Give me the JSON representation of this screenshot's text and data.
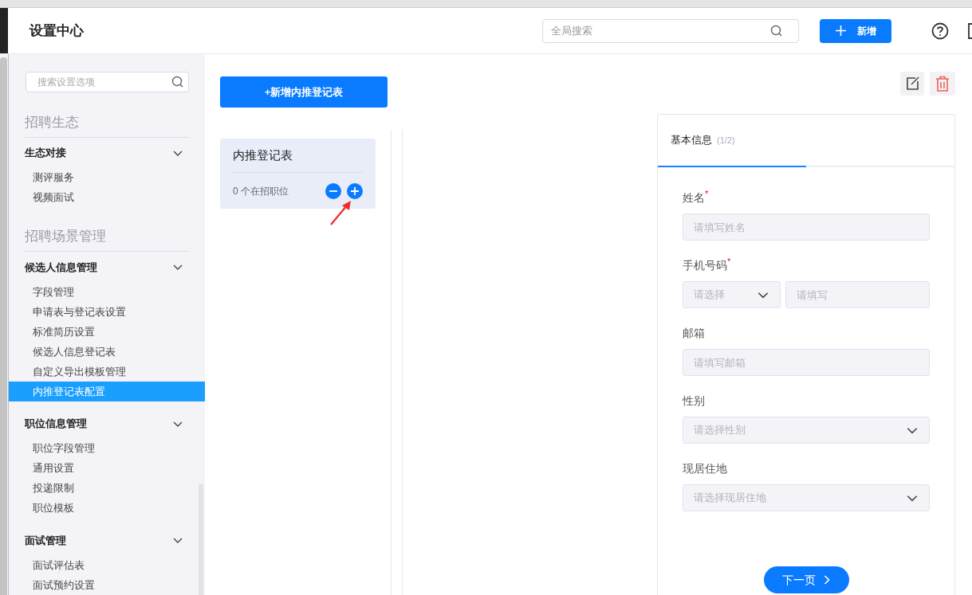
{
  "header": {
    "title": "设置中心",
    "search": {
      "placeholder": "全局搜索"
    },
    "add_button": "新增"
  },
  "sidebar": {
    "search": {
      "placeholder": "搜索设置选项"
    },
    "sections": [
      {
        "title": "招聘生态",
        "groups": [
          {
            "label": "生态对接",
            "expanded": true,
            "items": [
              {
                "label": "测评服务",
                "selected": false
              },
              {
                "label": "视频面试",
                "selected": false
              }
            ]
          }
        ]
      },
      {
        "title": "招聘场景管理",
        "groups": [
          {
            "label": "候选人信息管理",
            "expanded": true,
            "items": [
              {
                "label": "字段管理",
                "selected": false
              },
              {
                "label": "申请表与登记表设置",
                "selected": false
              },
              {
                "label": "标准简历设置",
                "selected": false
              },
              {
                "label": "候选人信息登记表",
                "selected": false
              },
              {
                "label": "自定义导出模板管理",
                "selected": false
              },
              {
                "label": "内推登记表配置",
                "selected": true
              }
            ]
          },
          {
            "label": "职位信息管理",
            "expanded": true,
            "items": [
              {
                "label": "职位字段管理",
                "selected": false
              },
              {
                "label": "通用设置",
                "selected": false
              },
              {
                "label": "投递限制",
                "selected": false
              },
              {
                "label": "职位模板",
                "selected": false
              }
            ]
          },
          {
            "label": "面试管理",
            "expanded": true,
            "items": [
              {
                "label": "面试评估表",
                "selected": false
              },
              {
                "label": "面试预约设置",
                "selected": false
              }
            ]
          }
        ]
      }
    ]
  },
  "toolbar": {
    "add_record_button": "+新增内推登记表"
  },
  "cards": [
    {
      "title": "内推登记表",
      "count": "0 个在招职位"
    }
  ],
  "form": {
    "tab": {
      "label": "基本信息",
      "step": "(1/2)",
      "level": 0.5
    },
    "required_mark": "*",
    "fields": [
      {
        "kind": "input",
        "label": "姓名",
        "required": true,
        "placeholder": "请填写姓名"
      },
      {
        "kind": "phone",
        "label": "手机号码",
        "required": true,
        "select_placeholder": "请选择",
        "placeholder": "请填写"
      },
      {
        "kind": "input",
        "label": "邮箱",
        "required": false,
        "placeholder": "请填写邮箱"
      },
      {
        "kind": "select",
        "label": "性别",
        "required": false,
        "placeholder": "请选择性别"
      },
      {
        "kind": "select",
        "label": "现居住地",
        "required": false,
        "placeholder": "请选择现居住地"
      }
    ],
    "next_button": "下一页"
  }
}
